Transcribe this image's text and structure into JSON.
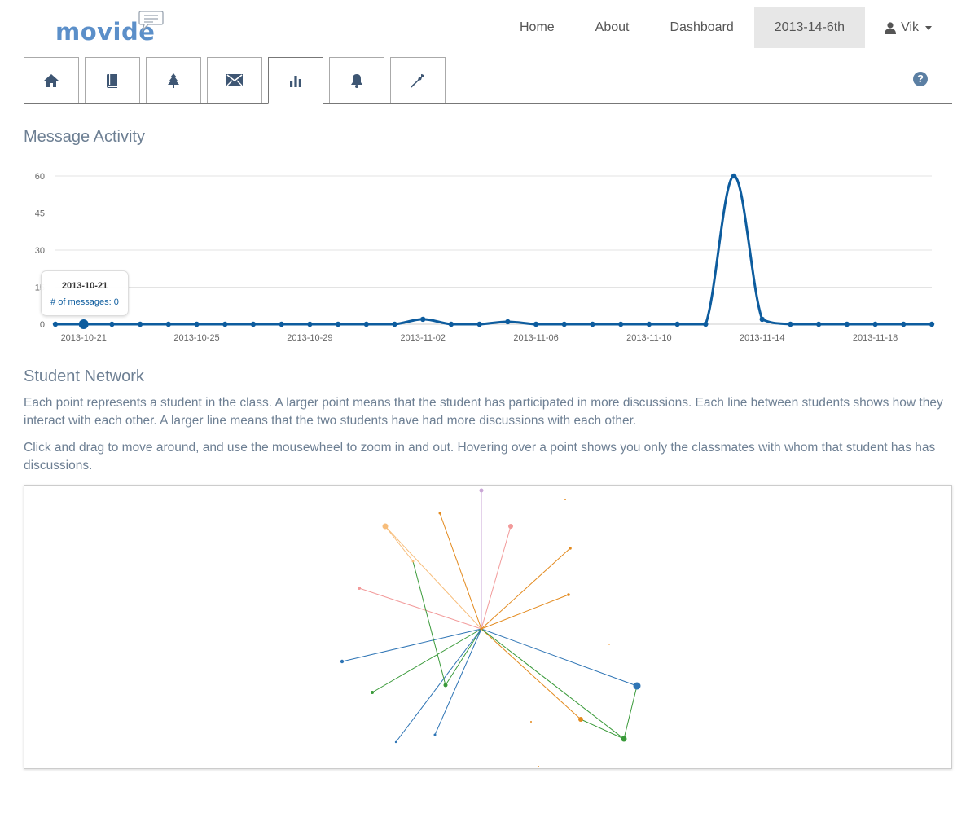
{
  "brand": {
    "name": "movide"
  },
  "nav": {
    "links": [
      "Home",
      "About",
      "Dashboard",
      "2013-14-6th"
    ],
    "active": "2013-14-6th",
    "user": "Vik"
  },
  "tabs": [
    {
      "icon": "home-icon"
    },
    {
      "icon": "book-icon"
    },
    {
      "icon": "tree-icon"
    },
    {
      "icon": "envelope-icon"
    },
    {
      "icon": "bar-chart-icon",
      "active": true
    },
    {
      "icon": "bell-icon"
    },
    {
      "icon": "wrench-icon"
    }
  ],
  "help_icon": "?",
  "activity": {
    "heading": "Message Activity"
  },
  "tooltip": {
    "date": "2013-10-21",
    "value": "# of messages: 0"
  },
  "network": {
    "heading": "Student Network",
    "paragraph1": "Each point represents a student in the class. A larger point means that the student has participated in more discussions. Each line between students shows how they interact with each other. A larger line means that the two students have had more discussions with each other.",
    "paragraph2": "Click and drag to move around, and use the mousewheel to zoom in and out. Hovering over a point shows you only the classmates with whom that student has has discussions."
  },
  "colors": {
    "line": "#0d5c9e",
    "accent": "#5b8fc9",
    "heading": "#6d7f93"
  },
  "chart_data": {
    "type": "line",
    "title": "",
    "x_start": "2013-10-20",
    "x_end": "2013-11-19",
    "x_tick_labels": [
      "2013-10-21",
      "2013-10-25",
      "2013-10-29",
      "2013-11-02",
      "2013-11-06",
      "2013-11-10",
      "2013-11-14",
      "2013-11-18"
    ],
    "ylim": [
      0,
      60
    ],
    "y_ticks": [
      0,
      15,
      30,
      45,
      60
    ],
    "grid": true,
    "highlighted_index": 1,
    "series": [
      {
        "values": [
          0,
          0,
          0,
          0,
          0,
          0,
          0,
          0,
          0,
          0,
          0,
          0,
          0,
          2,
          0,
          0,
          1,
          0,
          0,
          0,
          0,
          0,
          0,
          0,
          60,
          2,
          0,
          0,
          0,
          0,
          0,
          0
        ]
      }
    ]
  }
}
